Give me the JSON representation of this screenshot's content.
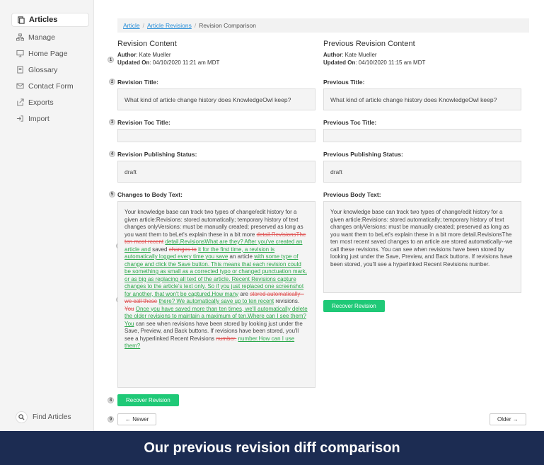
{
  "sidebar": {
    "items": [
      {
        "label": "Articles",
        "icon": "articles-icon"
      },
      {
        "label": "Manage",
        "icon": "sitemap-icon"
      },
      {
        "label": "Home Page",
        "icon": "monitor-icon"
      },
      {
        "label": "Glossary",
        "icon": "book-icon"
      },
      {
        "label": "Contact Form",
        "icon": "mail-icon"
      },
      {
        "label": "Exports",
        "icon": "export-icon"
      },
      {
        "label": "Import",
        "icon": "import-icon"
      }
    ],
    "find": "Find Articles"
  },
  "breadcrumb": {
    "article": "Article",
    "revisions": "Article Revisions",
    "current": "Revision Comparison",
    "sep": "/"
  },
  "left": {
    "title": "Revision Content",
    "author_label": "Author",
    "author": ": Kate Mueller",
    "updated_label": "Updated On",
    "updated": ": 04/10/2020 11:21 am MDT",
    "title_label": "Revision Title:",
    "title_value": "What kind of article change history does KnowledgeOwl keep?",
    "toc_label": "Revision Toc Title:",
    "status_label": "Revision Publishing Status:",
    "status_value": "draft",
    "body_label": "Changes to Body Text:",
    "body": {
      "t1": "Your knowledge base can track two types of change/edit history for a given article:Revisions: stored automatically; temporary history of text changes onlyVersions: must be manually created; preserved as long as you want them to beLet's explain these in a bit more ",
      "d1": "detail.RevisionsThe ten most recent",
      "i1": "detail.RevisionsWhat are they? After you've created an article and",
      "t2": " saved ",
      "d2": "changes to",
      "i2": "it for the first time, a revision is automatically logged every time you save",
      "t3": " an article ",
      "i3": "with some type of change and click the Save button. This means that each revision could be something as small as a corrected typo or changed punctuation mark, or as big as replacing all text of the article. Recent Revisions capture changes to the article's text only. So if you just replaced one screenshot for another, that won't be captured.How many",
      "t4": " are ",
      "d3": "stored automatically--we call these",
      "i4": "there? We automatically save up to ten recent",
      "t5": " revisions. ",
      "d4": "You",
      "i5": "Once you have saved more than ten times, we'll automatically delete the older revisions to maintain a maximum of ten.Where can I see them?You",
      "t6": " can see when revisions have been stored by looking just under the Save, Preview, and Back buttons. If revisions have been stored, you'll see a hyperlinked Recent Revisions ",
      "d5": "number.",
      "i6": "number.How can I use them?"
    },
    "recover": "Recover Revision"
  },
  "right": {
    "title": "Previous Revision Content",
    "author_label": "Author",
    "author": ": Kate Mueller",
    "updated_label": "Updated On",
    "updated": ": 04/10/2020 11:15 am MDT",
    "title_label": "Previous Title:",
    "title_value": "What kind of article change history does KnowledgeOwl keep?",
    "toc_label": "Previous Toc Title:",
    "status_label": "Previous Publishing Status:",
    "status_value": "draft",
    "body_label": "Previous Body Text:",
    "body": "Your knowledge base can track two types of change/edit history for a given article:Revisions: stored automatically; temporary history of text changes onlyVersions: must be manually created; preserved as long as you want them to beLet's explain these in a bit more detail.RevisionsThe ten most recent saved changes to an article are stored automatically--we call these revisions. You can see when revisions have been stored by looking just under the Save, Preview, and Back buttons. If revisions have been stored, you'll see a hyperlinked Recent Revisions number.",
    "recover": "Recover Revision"
  },
  "nav": {
    "newer": "← Newer",
    "older": "Older →"
  },
  "steps": [
    "1",
    "2",
    "3",
    "4",
    "5",
    "6",
    "7",
    "8",
    "9"
  ],
  "banner": "Our previous revision diff comparison",
  "colors": {
    "accent": "#1fc977",
    "link": "#2a8fd8",
    "deleted": "#e05555",
    "inserted": "#2aa84a",
    "banner": "#1c2c52"
  }
}
